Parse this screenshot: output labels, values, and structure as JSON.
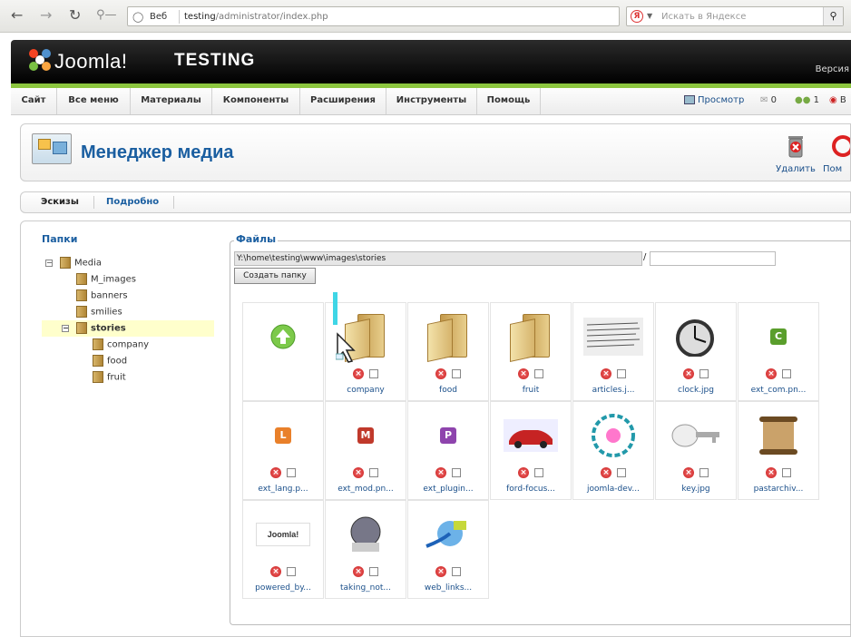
{
  "browser": {
    "tab_label": "Веб",
    "url_host": "testing",
    "url_path": "/administrator/index.php",
    "search_placeholder": "Искать в Яндексе",
    "yandex_letter": "Я"
  },
  "header": {
    "brand": "Joomla!",
    "site_name": "TESTING",
    "version_text": "Версия"
  },
  "menu": {
    "items": [
      "Сайт",
      "Все меню",
      "Материалы",
      "Компоненты",
      "Расширения",
      "Инструменты",
      "Помощь"
    ],
    "preview": "Просмотр",
    "messages_count": "0",
    "users_count": "1",
    "logout_fragment": "В"
  },
  "toolbar": {
    "title": "Менеджер медиа",
    "delete_label": "Удалить",
    "help_label": "Пом"
  },
  "view_tabs": {
    "thumbnails": "Эскизы",
    "details": "Подробно"
  },
  "folders": {
    "title": "Папки",
    "tree": [
      {
        "label": "Media",
        "toggle": "−"
      },
      {
        "label": "M_images"
      },
      {
        "label": "banners"
      },
      {
        "label": "smilies"
      },
      {
        "label": "stories",
        "toggle": "−",
        "selected": true
      },
      {
        "label": "company"
      },
      {
        "label": "food"
      },
      {
        "label": "fruit"
      }
    ]
  },
  "files": {
    "title": "Файлы",
    "path": "Y:\\home\\testing\\www\\images\\stories",
    "path_separator": "/",
    "create_folder_label": "Создать папку",
    "items": [
      {
        "name": "",
        "kind": "up"
      },
      {
        "name": "company",
        "kind": "folder"
      },
      {
        "name": "food",
        "kind": "folder"
      },
      {
        "name": "fruit",
        "kind": "folder"
      },
      {
        "name": "articles.j...",
        "kind": "image-paper"
      },
      {
        "name": "clock.jpg",
        "kind": "image-clock"
      },
      {
        "name": "ext_com.pn...",
        "kind": "badge",
        "letter": "C",
        "color": "#5a9e2c"
      },
      {
        "name": "ext_lang.p...",
        "kind": "badge",
        "letter": "L",
        "color": "#e9802a"
      },
      {
        "name": "ext_mod.pn...",
        "kind": "badge",
        "letter": "M",
        "color": "#c0392b"
      },
      {
        "name": "ext_plugin...",
        "kind": "badge",
        "letter": "P",
        "color": "#8e44ad"
      },
      {
        "name": "ford-focus...",
        "kind": "image-car"
      },
      {
        "name": "joomla-dev...",
        "kind": "image-diagram"
      },
      {
        "name": "key.jpg",
        "kind": "image-key"
      },
      {
        "name": "pastarchiv...",
        "kind": "image-scroll"
      },
      {
        "name": "powered_by...",
        "kind": "image-powered",
        "logo_text": "Joomla!"
      },
      {
        "name": "taking_not...",
        "kind": "image-notes"
      },
      {
        "name": "web_links...",
        "kind": "image-links"
      }
    ]
  },
  "colors": {
    "accent_blue": "#1a5ea0",
    "header_green": "#8cc63e",
    "delete_red": "#c81d1d"
  }
}
